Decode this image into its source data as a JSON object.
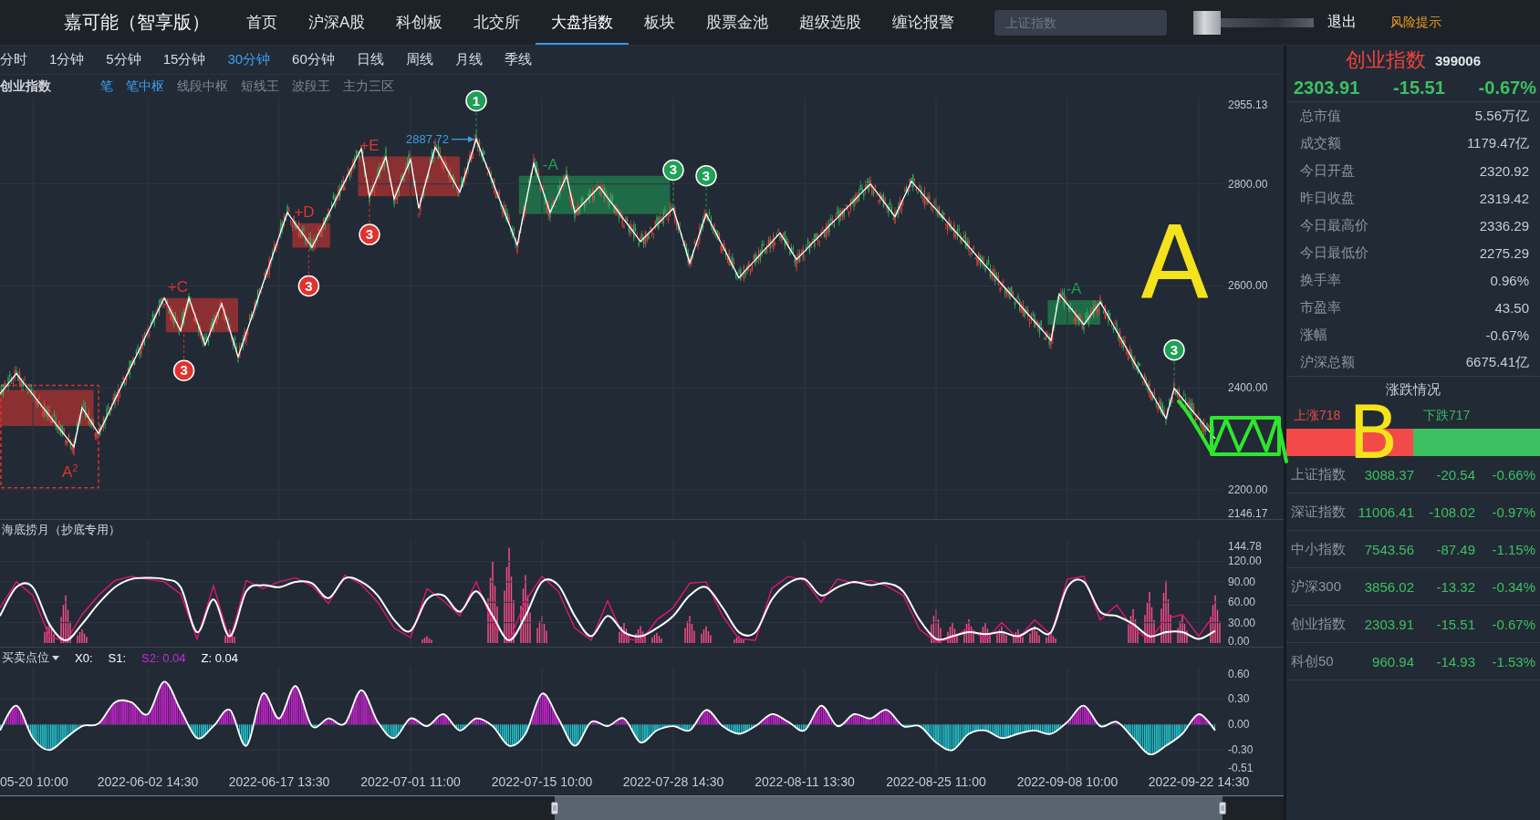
{
  "header": {
    "logo": "嘉可能（智享版）",
    "nav": [
      {
        "label": "首页",
        "selected": false
      },
      {
        "label": "沪深A股",
        "selected": false
      },
      {
        "label": "科创板",
        "selected": false
      },
      {
        "label": "北交所",
        "selected": false
      },
      {
        "label": "大盘指数",
        "selected": true
      },
      {
        "label": "板块",
        "selected": false
      },
      {
        "label": "股票金池",
        "selected": false
      },
      {
        "label": "超级选股",
        "selected": false
      },
      {
        "label": "缠论报警",
        "selected": false
      }
    ],
    "search": {
      "placeholder": "上证指数"
    },
    "logout": "退出",
    "risk_link": "风险提示"
  },
  "periods": [
    {
      "label": "分时",
      "selected": false
    },
    {
      "label": "1分钟",
      "selected": false
    },
    {
      "label": "5分钟",
      "selected": false
    },
    {
      "label": "15分钟",
      "selected": false
    },
    {
      "label": "30分钟",
      "selected": true
    },
    {
      "label": "60分钟",
      "selected": false
    },
    {
      "label": "日线",
      "selected": false
    },
    {
      "label": "周线",
      "selected": false
    },
    {
      "label": "月线",
      "selected": false
    },
    {
      "label": "季线",
      "selected": false
    }
  ],
  "main_chart": {
    "title": "创业指数",
    "tools": [
      {
        "label": "笔",
        "on": true
      },
      {
        "label": "笔中枢",
        "on": true
      },
      {
        "label": "线段中枢",
        "on": false
      },
      {
        "label": "短线王",
        "on": false
      },
      {
        "label": "波段王",
        "on": false
      },
      {
        "label": "主力三区",
        "on": false
      }
    ],
    "chart_data": {
      "type": "line",
      "grid": true,
      "categories": [
        null,
        null,
        null,
        null,
        null,
        null,
        null,
        null,
        null,
        null,
        null,
        null,
        null,
        null,
        null,
        null,
        null,
        null,
        null,
        null,
        null,
        null,
        null,
        null,
        null,
        null,
        null,
        null,
        null,
        null,
        null,
        null,
        null,
        null,
        null,
        null,
        null,
        null,
        null,
        null,
        null,
        null,
        null,
        null,
        null,
        null,
        null,
        null,
        null,
        null,
        null,
        null,
        null,
        null,
        null,
        null,
        null,
        null,
        null,
        null,
        null,
        null,
        null,
        null,
        null,
        null,
        null,
        null,
        null,
        null,
        null,
        null,
        null,
        null,
        null,
        null,
        null,
        null,
        null,
        null,
        null,
        null,
        null,
        null,
        null,
        null,
        null,
        null,
        null,
        null,
        null,
        null,
        null,
        null,
        null,
        null,
        null,
        null,
        null,
        null,
        null,
        null,
        null,
        null,
        null,
        null,
        null,
        null,
        null,
        null,
        null,
        null,
        null,
        null,
        null,
        null,
        null,
        null,
        null,
        null,
        null,
        null,
        null,
        null,
        null,
        null,
        null,
        null,
        null,
        null,
        null,
        null,
        null,
        null,
        null,
        null,
        null,
        null,
        null,
        null,
        null,
        null,
        null,
        null,
        null,
        null,
        null,
        null,
        null
      ],
      "series": [
        {
          "color": "#ffffff",
          "values": [
            2388,
            2408,
            2428,
            2407,
            2387,
            2366,
            2346,
            2325,
            2305,
            2284,
            2361,
            2336,
            2310,
            2343,
            2377,
            2410,
            2443,
            2476,
            2510,
            2543,
            2576,
            2544,
            2512,
            2576,
            2530,
            2484,
            2525,
            2565,
            2513,
            2461,
            2508,
            2555,
            2603,
            2650,
            2697,
            2744,
            2721,
            2699,
            2676,
            2708,
            2740,
            2773,
            2805,
            2837,
            2869,
            2776,
            2815,
            2853,
            2771,
            2810,
            2848,
            2752,
            2812,
            2872,
            2843,
            2813,
            2784,
            2836,
            2888,
            2846,
            2805,
            2763,
            2722,
            2680,
            2760,
            2840,
            2792,
            2744,
            2780,
            2816,
            2744,
            2761,
            2778,
            2795,
            2773,
            2752,
            2730,
            2709,
            2687,
            2703,
            2720,
            2736,
            2752,
            2699,
            2645,
            2693,
            2741,
            2710,
            2679,
            2647,
            2616,
            2634,
            2651,
            2669,
            2686,
            2704,
            2678,
            2652,
            2668,
            2685,
            2701,
            2718,
            2734,
            2751,
            2767,
            2784,
            2800,
            2779,
            2757,
            2736,
            2771,
            2805,
            2787,
            2768,
            2750,
            2732,
            2713,
            2695,
            2677,
            2658,
            2640,
            2622,
            2603,
            2585,
            2567,
            2548,
            2530,
            2512,
            2493,
            2584,
            2564,
            2544,
            2524,
            2546,
            2568,
            2540,
            2511,
            2483,
            2454,
            2426,
            2397,
            2369,
            2340,
            2399,
            2379,
            2359,
            2340,
            2320,
            2300
          ]
        }
      ],
      "ylim": [
        2146.17,
        2955.13
      ],
      "yticks": [
        {
          "value": 2146.17,
          "label": "2146.17"
        },
        {
          "value": 2200,
          "label": "2200.00"
        },
        {
          "value": 2400,
          "label": "2400.00"
        },
        {
          "value": 2600,
          "label": "2600.00"
        },
        {
          "value": 2800,
          "label": "2800.00"
        },
        {
          "value": 2955.13,
          "label": "2955.13"
        }
      ]
    },
    "frames": [
      {
        "label": "A$^{2}$",
        "color": "#e0332f"
      }
    ],
    "pivots": [
      {
        "label": "+C",
        "color": "#e0332f"
      },
      {
        "label": "+D",
        "color": "#e0332f"
      },
      {
        "label": "+E",
        "color": "#e0332f"
      },
      {
        "label": "-A",
        "color": "#1fa055"
      },
      {
        "label": "-A",
        "color": "#1fa055"
      }
    ],
    "signals": [
      {
        "label": "1",
        "color": "#1fa055"
      },
      {
        "label": "3",
        "color": "#e0332f"
      },
      {
        "label": "3",
        "color": "#e0332f"
      },
      {
        "label": "3",
        "color": "#e0332f"
      },
      {
        "label": "3",
        "color": "#1fa055"
      },
      {
        "label": "3",
        "color": "#1fa055"
      },
      {
        "label": "3",
        "color": "#1fa055"
      }
    ],
    "price_tag": {
      "label": "2887.72",
      "color": "#3a9ee8"
    }
  },
  "indicator_1": {
    "title": "海底捞月（抄底专用）",
    "chart_data": {
      "type": "line",
      "grid": true,
      "categories": [
        null,
        null,
        null,
        null,
        null,
        null,
        null,
        null,
        null,
        null,
        null,
        null,
        null,
        null,
        null,
        null,
        null,
        null,
        null,
        null,
        null,
        null,
        null,
        null,
        null,
        null,
        null,
        null,
        null,
        null,
        null,
        null,
        null,
        null,
        null,
        null,
        null,
        null,
        null,
        null,
        null,
        null,
        null,
        null,
        null,
        null,
        null,
        null,
        null,
        null,
        null,
        null,
        null,
        null,
        null,
        null,
        null,
        null,
        null,
        null,
        null,
        null,
        null,
        null,
        null,
        null,
        null,
        null,
        null,
        null,
        null,
        null,
        null,
        null,
        null
      ],
      "series": [
        {
          "color": "#e0157a",
          "values": [
            52,
            90,
            70,
            10,
            2,
            42,
            70,
            92,
            98,
            94,
            90,
            72,
            6,
            84,
            4,
            92,
            80,
            90,
            96,
            84,
            58,
            100,
            86,
            60,
            22,
            8,
            80,
            62,
            40,
            90,
            30,
            2,
            62,
            98,
            76,
            22,
            4,
            62,
            8,
            2,
            34,
            52,
            88,
            90,
            40,
            6,
            4,
            80,
            98,
            92,
            60,
            94,
            88,
            92,
            84,
            70,
            20,
            2,
            6,
            24,
            4,
            30,
            6,
            34,
            12,
            94,
            98,
            34,
            56,
            22,
            4,
            36,
            42,
            10,
            44
          ]
        },
        {
          "color": "#ffffff",
          "values": [
            40,
            82,
            82,
            28,
            4,
            28,
            58,
            82,
            94,
            96,
            94,
            82,
            16,
            64,
            10,
            76,
            85,
            82,
            90,
            88,
            66,
            95,
            90,
            70,
            34,
            18,
            64,
            70,
            46,
            76,
            40,
            4,
            40,
            90,
            85,
            40,
            10,
            40,
            16,
            10,
            22,
            40,
            70,
            82,
            52,
            16,
            16,
            64,
            88,
            94,
            70,
            82,
            90,
            85,
            88,
            76,
            34,
            6,
            10,
            16,
            13,
            16,
            10,
            22,
            16,
            82,
            90,
            46,
            40,
            28,
            10,
            16,
            16,
            6,
            18
          ]
        }
      ],
      "ylim": [
        0,
        144.78
      ],
      "yticks": [
        {
          "value": 0,
          "label": "0.00"
        },
        {
          "value": 30,
          "label": "30.00"
        },
        {
          "value": 60,
          "label": "60.00"
        },
        {
          "value": 90,
          "label": "90.00"
        },
        {
          "value": 120,
          "label": "120.00"
        },
        {
          "value": 144.78,
          "label": "144.78"
        }
      ]
    }
  },
  "indicator_2": {
    "selector": "买卖点位",
    "legend": [
      {
        "label": "X0:",
        "color": "#ffffff"
      },
      {
        "label": "S1:",
        "color": "#ffffff"
      },
      {
        "label": "S2:",
        "value": "0.04",
        "color": "#c52bd6"
      },
      {
        "label": "Z:",
        "value": "0.04",
        "color": "#ffffff"
      }
    ],
    "chart_data": {
      "type": "area",
      "grid": true,
      "categories": [
        null,
        null,
        "05-20 10:00",
        null,
        null,
        null,
        null,
        null,
        null,
        "2022-06-02 14:30",
        null,
        null,
        null,
        null,
        null,
        null,
        null,
        "2022-06-17 13:30",
        null,
        null,
        null,
        null,
        null,
        null,
        null,
        "2022-07-01 11:00",
        null,
        null,
        null,
        null,
        null,
        null,
        null,
        "2022-07-15 10:00",
        null,
        null,
        null,
        null,
        null,
        null,
        null,
        "2022-07-28 14:30",
        null,
        null,
        null,
        null,
        null,
        null,
        null,
        "2022-08-11 13:30",
        null,
        null,
        null,
        null,
        null,
        null,
        null,
        "2022-08-25 11:00",
        null,
        null,
        null,
        null,
        null,
        null,
        null,
        "2022-09-08 10:00",
        null,
        null,
        null,
        null,
        null,
        null,
        null,
        "2022-09-22 14:30",
        null
      ],
      "series": [
        {
          "color": "#ffffff",
          "values": [
            -0.07,
            0.22,
            -0.16,
            -0.3,
            -0.16,
            -0.02,
            0.01,
            0.26,
            0.26,
            0.12,
            0.5,
            0.17,
            -0.16,
            -0.02,
            0.17,
            -0.25,
            0.36,
            0.07,
            0.45,
            -0.02,
            0.07,
            0.01,
            0.4,
            0.03,
            -0.16,
            0.07,
            -0.02,
            0.12,
            -0.07,
            0.07,
            -0.02,
            -0.25,
            -0.11,
            0.36,
            0.07,
            -0.25,
            0.03,
            -0.02,
            0.07,
            -0.21,
            -0.07,
            -0.02,
            -0.07,
            0.17,
            -0.02,
            -0.11,
            -0.02,
            0.12,
            0.03,
            -0.07,
            0.22,
            -0.02,
            0.12,
            0.07,
            0.17,
            -0.02,
            -0.02,
            -0.21,
            -0.3,
            -0.11,
            -0.07,
            -0.16,
            -0.11,
            -0.07,
            -0.11,
            0.03,
            0.22,
            -0.02,
            0.03,
            -0.16,
            -0.35,
            -0.25,
            -0.11,
            0.12,
            -0.07
          ]
        }
      ],
      "ylim": [
        -0.51,
        0.6
      ],
      "yticks": [
        {
          "value": -0.51,
          "label": "-0.51"
        },
        {
          "value": -0.3,
          "label": "-0.30"
        },
        {
          "value": 0,
          "label": "0.00"
        },
        {
          "value": 0.3,
          "label": "0.30"
        },
        {
          "value": 0.6,
          "label": "0.60"
        }
      ]
    }
  },
  "quote_panel": {
    "name": "创业指数",
    "code": "399006",
    "price": "2303.91",
    "change": "-15.51",
    "change_pct": "-0.67%",
    "stats": [
      {
        "label": "总市值",
        "value": "5.56万亿"
      },
      {
        "label": "成交额",
        "value": "1179.47亿"
      },
      {
        "label": "今日开盘",
        "value": "2320.92"
      },
      {
        "label": "昨日收盘",
        "value": "2319.42"
      },
      {
        "label": "今日最高价",
        "value": "2336.29"
      },
      {
        "label": "今日最低价",
        "value": "2275.29"
      },
      {
        "label": "换手率",
        "value": "0.96%"
      },
      {
        "label": "市盈率",
        "value": "43.50"
      },
      {
        "label": "涨幅",
        "value": "-0.67%"
      },
      {
        "label": "沪深总额",
        "value": "6675.41亿"
      }
    ],
    "breadth": {
      "title": "涨跌情况",
      "up": "上涨718",
      "down": "下跌717",
      "level": 0.5
    },
    "indices": [
      {
        "name": "上证指数",
        "value": "3088.37",
        "change": "-20.54",
        "change_pct": "-0.66%"
      },
      {
        "name": "深证指数",
        "value": "11006.41",
        "change": "-108.02",
        "change_pct": "-0.97%"
      },
      {
        "name": "中小指数",
        "value": "7543.56",
        "change": "-87.49",
        "change_pct": "-1.15%"
      },
      {
        "name": "沪深300",
        "value": "3856.02",
        "change": "-13.32",
        "change_pct": "-0.34%"
      },
      {
        "name": "创业指数",
        "value": "2303.91",
        "change": "-15.51",
        "change_pct": "-0.67%"
      },
      {
        "name": "科创50",
        "value": "960.94",
        "change": "-14.93",
        "change_pct": "-1.53%"
      }
    ]
  },
  "markup": [
    {
      "kind": "letter",
      "text": "A",
      "color": "#f4e31c"
    },
    {
      "kind": "letter",
      "text": "B",
      "color": "#f4e31c"
    },
    {
      "kind": "scribble",
      "color": "#2ee62e"
    }
  ]
}
